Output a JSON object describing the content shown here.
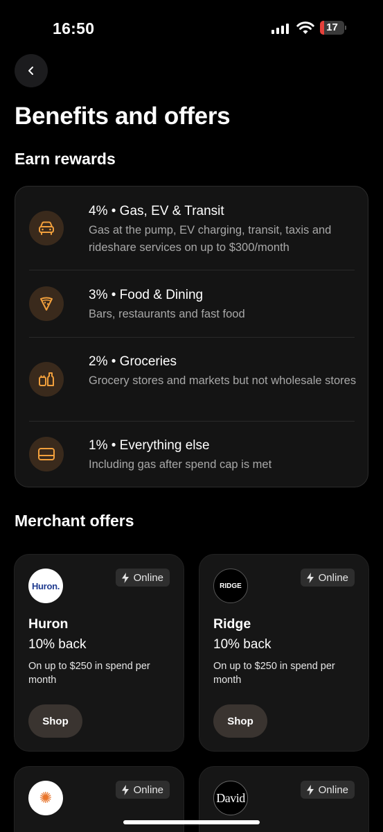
{
  "status_bar": {
    "time": "16:50",
    "battery": "17",
    "battery_fraction": 0.17
  },
  "header": {
    "back_icon": "chevron-left-icon",
    "title": "Benefits and offers"
  },
  "earn_rewards": {
    "title": "Earn rewards",
    "accent_color": "#f2a03c",
    "items": [
      {
        "icon": "car-icon",
        "title": "4% • Gas, EV & Transit",
        "description": "Gas at the pump, EV charging, transit, taxis and rideshare services on up to $300/month"
      },
      {
        "icon": "pizza-icon",
        "title": "3% • Food & Dining",
        "description": "Bars, restaurants and fast food"
      },
      {
        "icon": "grocery-icon",
        "title": "2% • Groceries",
        "description": "Grocery stores and markets but not wholesale stores"
      },
      {
        "icon": "card-icon",
        "title": "1% • Everything else",
        "description": "Including gas after spend cap is met"
      }
    ]
  },
  "merchant_offers": {
    "title": "Merchant offers",
    "offers": [
      {
        "logo_text": "Huron.",
        "name": "Huron",
        "badge": "Online",
        "rate": "10% back",
        "terms": "On up to $250 in spend per month",
        "button": "Shop"
      },
      {
        "logo_text": "RIDGE",
        "name": "Ridge",
        "badge": "Online",
        "rate": "10% back",
        "terms": "On up to $250 in spend per month",
        "button": "Shop"
      },
      {
        "logo_text": "✺",
        "badge": "Online"
      },
      {
        "logo_text": "David",
        "badge": "Online"
      }
    ]
  }
}
